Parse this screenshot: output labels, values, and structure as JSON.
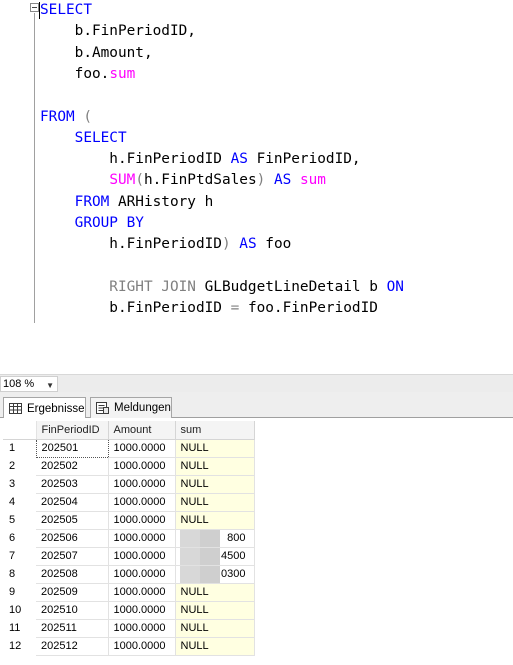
{
  "editor": {
    "lines": [
      [
        {
          "t": "SELECT",
          "c": "kw"
        }
      ],
      [
        {
          "t": "    b.FinPeriodID,",
          "c": "plain"
        }
      ],
      [
        {
          "t": "    b.Amount,",
          "c": "plain"
        }
      ],
      [
        {
          "t": "    foo.",
          "c": "plain"
        },
        {
          "t": "sum",
          "c": "fn"
        }
      ],
      [],
      [
        {
          "t": "FROM",
          "c": "kw"
        },
        {
          "t": " (",
          "c": "gray"
        }
      ],
      [
        {
          "t": "    SELECT",
          "c": "kw"
        }
      ],
      [
        {
          "t": "        h.FinPeriodID ",
          "c": "plain"
        },
        {
          "t": "AS",
          "c": "kw"
        },
        {
          "t": " FinPeriodID,",
          "c": "plain"
        }
      ],
      [
        {
          "t": "        ",
          "c": "plain"
        },
        {
          "t": "SUM",
          "c": "fn"
        },
        {
          "t": "(",
          "c": "gray"
        },
        {
          "t": "h.FinPtdSales",
          "c": "plain"
        },
        {
          "t": ")",
          "c": "gray"
        },
        {
          "t": " AS",
          "c": "kw"
        },
        {
          "t": " sum",
          "c": "fn"
        }
      ],
      [
        {
          "t": "    FROM",
          "c": "kw"
        },
        {
          "t": " ARHistory h",
          "c": "plain"
        }
      ],
      [
        {
          "t": "    GROUP BY",
          "c": "kw"
        }
      ],
      [
        {
          "t": "        h.FinPeriodID",
          "c": "plain"
        },
        {
          "t": ")",
          "c": "gray"
        },
        {
          "t": " AS",
          "c": "kw"
        },
        {
          "t": " foo",
          "c": "plain"
        }
      ],
      [],
      [
        {
          "t": "        RIGHT JOIN",
          "c": "gray"
        },
        {
          "t": " GLBudgetLineDetail b ",
          "c": "plain"
        },
        {
          "t": "ON",
          "c": "kw"
        }
      ],
      [
        {
          "t": "        b.FinPeriodID ",
          "c": "plain"
        },
        {
          "t": "=",
          "c": "gray"
        },
        {
          "t": " foo.FinPeriodID",
          "c": "plain"
        }
      ]
    ]
  },
  "zoom": {
    "value": "108 %"
  },
  "tabs": {
    "results": "Ergebnisse",
    "messages": "Meldungen"
  },
  "grid": {
    "columns": [
      "FinPeriodID",
      "Amount",
      "sum"
    ],
    "rows": [
      {
        "num": "1",
        "period": "202501",
        "amount": "1000.0000",
        "sum": "NULL",
        "redacted": false
      },
      {
        "num": "2",
        "period": "202502",
        "amount": "1000.0000",
        "sum": "NULL",
        "redacted": false
      },
      {
        "num": "3",
        "period": "202503",
        "amount": "1000.0000",
        "sum": "NULL",
        "redacted": false
      },
      {
        "num": "4",
        "period": "202504",
        "amount": "1000.0000",
        "sum": "NULL",
        "redacted": false
      },
      {
        "num": "5",
        "period": "202505",
        "amount": "1000.0000",
        "sum": "NULL",
        "redacted": false
      },
      {
        "num": "6",
        "period": "202506",
        "amount": "1000.0000",
        "sum": "800",
        "redacted": true
      },
      {
        "num": "7",
        "period": "202507",
        "amount": "1000.0000",
        "sum": "4500",
        "redacted": true
      },
      {
        "num": "8",
        "period": "202508",
        "amount": "1000.0000",
        "sum": "0300",
        "redacted": true
      },
      {
        "num": "9",
        "period": "202509",
        "amount": "1000.0000",
        "sum": "NULL",
        "redacted": false
      },
      {
        "num": "10",
        "period": "202510",
        "amount": "1000.0000",
        "sum": "NULL",
        "redacted": false
      },
      {
        "num": "11",
        "period": "202511",
        "amount": "1000.0000",
        "sum": "NULL",
        "redacted": false
      },
      {
        "num": "12",
        "period": "202512",
        "amount": "1000.0000",
        "sum": "NULL",
        "redacted": false
      }
    ]
  },
  "colors": {
    "keyword": "#0000ff",
    "function": "#ff00ff",
    "operator": "#808080",
    "null_background": "#ffffe1"
  }
}
